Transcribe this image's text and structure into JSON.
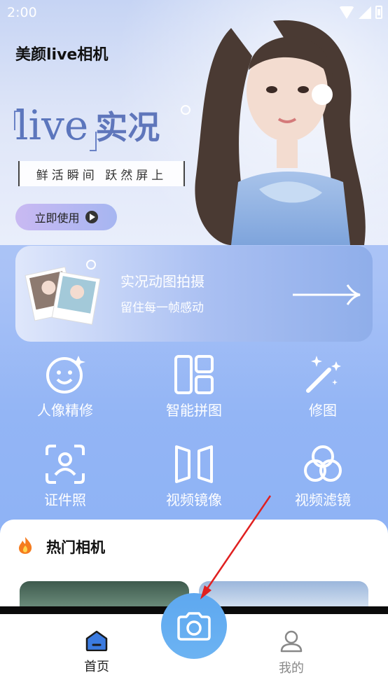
{
  "status_bar": {
    "time": "2:00"
  },
  "banner": {
    "app_title": "美颜live相机",
    "live_word": "live",
    "live_cn": "实况",
    "slogan": "鲜活瞬间  跃然屏上",
    "cta_label": "立即使用"
  },
  "feature_card": {
    "title": "实况动图拍摄",
    "subtitle": "留住每一帧感动"
  },
  "tools": [
    {
      "label": "人像精修",
      "icon": "face-smile-icon"
    },
    {
      "label": "智能拼图",
      "icon": "collage-icon"
    },
    {
      "label": "修图",
      "icon": "magic-wand-icon"
    },
    {
      "label": "证件照",
      "icon": "id-photo-icon"
    },
    {
      "label": "视频镜像",
      "icon": "mirror-icon"
    },
    {
      "label": "视频滤镜",
      "icon": "filter-circles-icon"
    }
  ],
  "hot": {
    "title": "热门相机"
  },
  "nav": {
    "home_label": "首页",
    "me_label": "我的"
  },
  "colors": {
    "accent": "#5ea8f0",
    "background": "#8fb3f5",
    "annotation": "#e02020"
  }
}
